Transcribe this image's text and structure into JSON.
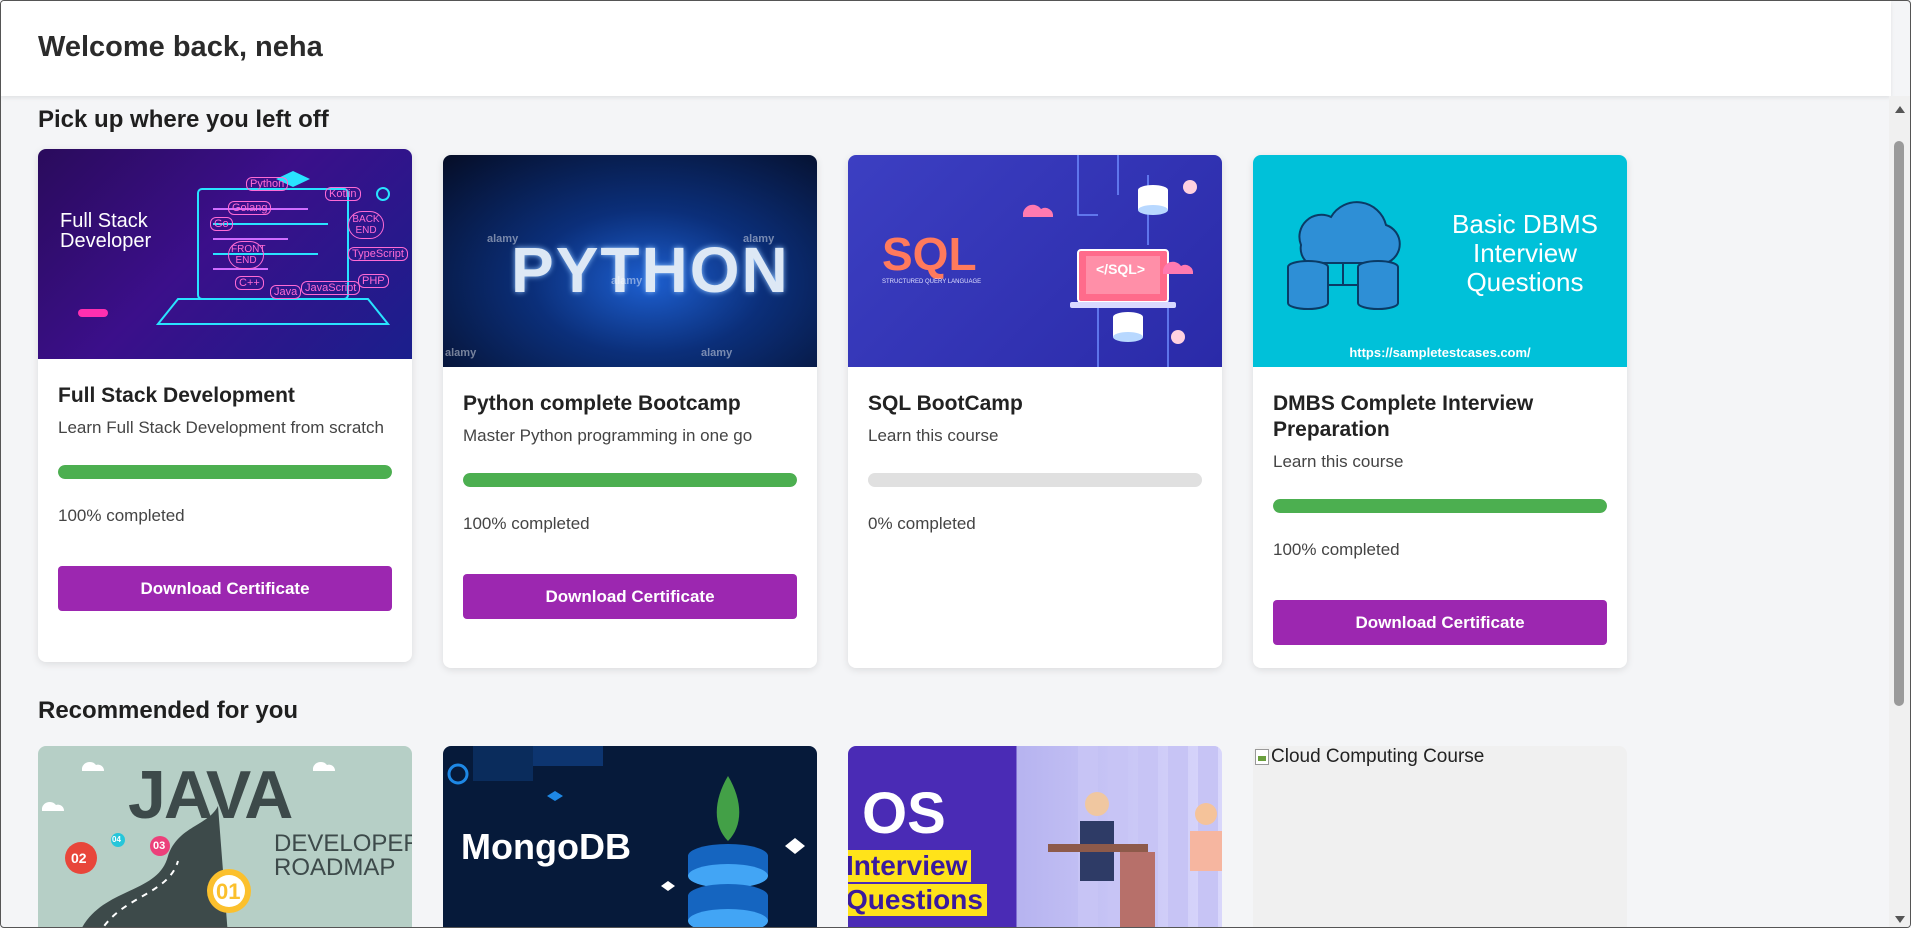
{
  "header": {
    "welcome": "Welcome back, neha"
  },
  "sections": {
    "continue_title": "Pick up where you left off",
    "recommended_title": "Recommended for you"
  },
  "courses": [
    {
      "title": "Full Stack Development",
      "description": "Learn Full Stack Development from scratch",
      "progress": 100,
      "progress_label": "100% completed",
      "button": "Download Certificate",
      "thumb": {
        "heading": [
          "Full Stack",
          "Developer"
        ],
        "tags": [
          "Python",
          "Golang",
          "Kotlin",
          "Go",
          "FRONT END",
          "BACK END",
          "TypeScript",
          "C++",
          "Java",
          "JavaScript",
          "PHP"
        ]
      }
    },
    {
      "title": "Python complete Bootcamp",
      "description": "Master Python programming in one go",
      "progress": 100,
      "progress_label": "100% completed",
      "button": "Download Certificate",
      "thumb": {
        "word": "PYTHON",
        "watermark": "alamy"
      }
    },
    {
      "title": "SQL BootCamp",
      "description": "Learn this course",
      "progress": 0,
      "progress_label": "0% completed",
      "button": "",
      "thumb": {
        "word": "SQL",
        "sub": "STRUCTURED QUERY LANGUAGE",
        "screen": "</SQL>"
      }
    },
    {
      "title": "DMBS Complete Interview Preparation",
      "description": "Learn this course",
      "progress": 100,
      "progress_label": "100% completed",
      "button": "Download Certificate",
      "thumb": {
        "heading": [
          "Basic DBMS",
          "Interview",
          "Questions"
        ],
        "url": "https://sampletestcases.com/"
      }
    }
  ],
  "recommended": [
    {
      "name": "java",
      "thumb": {
        "word": "JAVA",
        "sub": [
          "DEVELOPER",
          "ROADMAP"
        ],
        "markers": [
          "02",
          "04",
          "03",
          "01"
        ]
      }
    },
    {
      "name": "mongodb",
      "thumb": {
        "word": "MongoDB"
      }
    },
    {
      "name": "os",
      "thumb": {
        "word": "OS",
        "sub": [
          "Interview",
          "Questions"
        ]
      }
    },
    {
      "name": "cloud",
      "alt": "Cloud Computing Course"
    }
  ],
  "colors": {
    "accent": "#9c27b0",
    "progress": "#4caf50",
    "track": "#e0e0e0"
  }
}
